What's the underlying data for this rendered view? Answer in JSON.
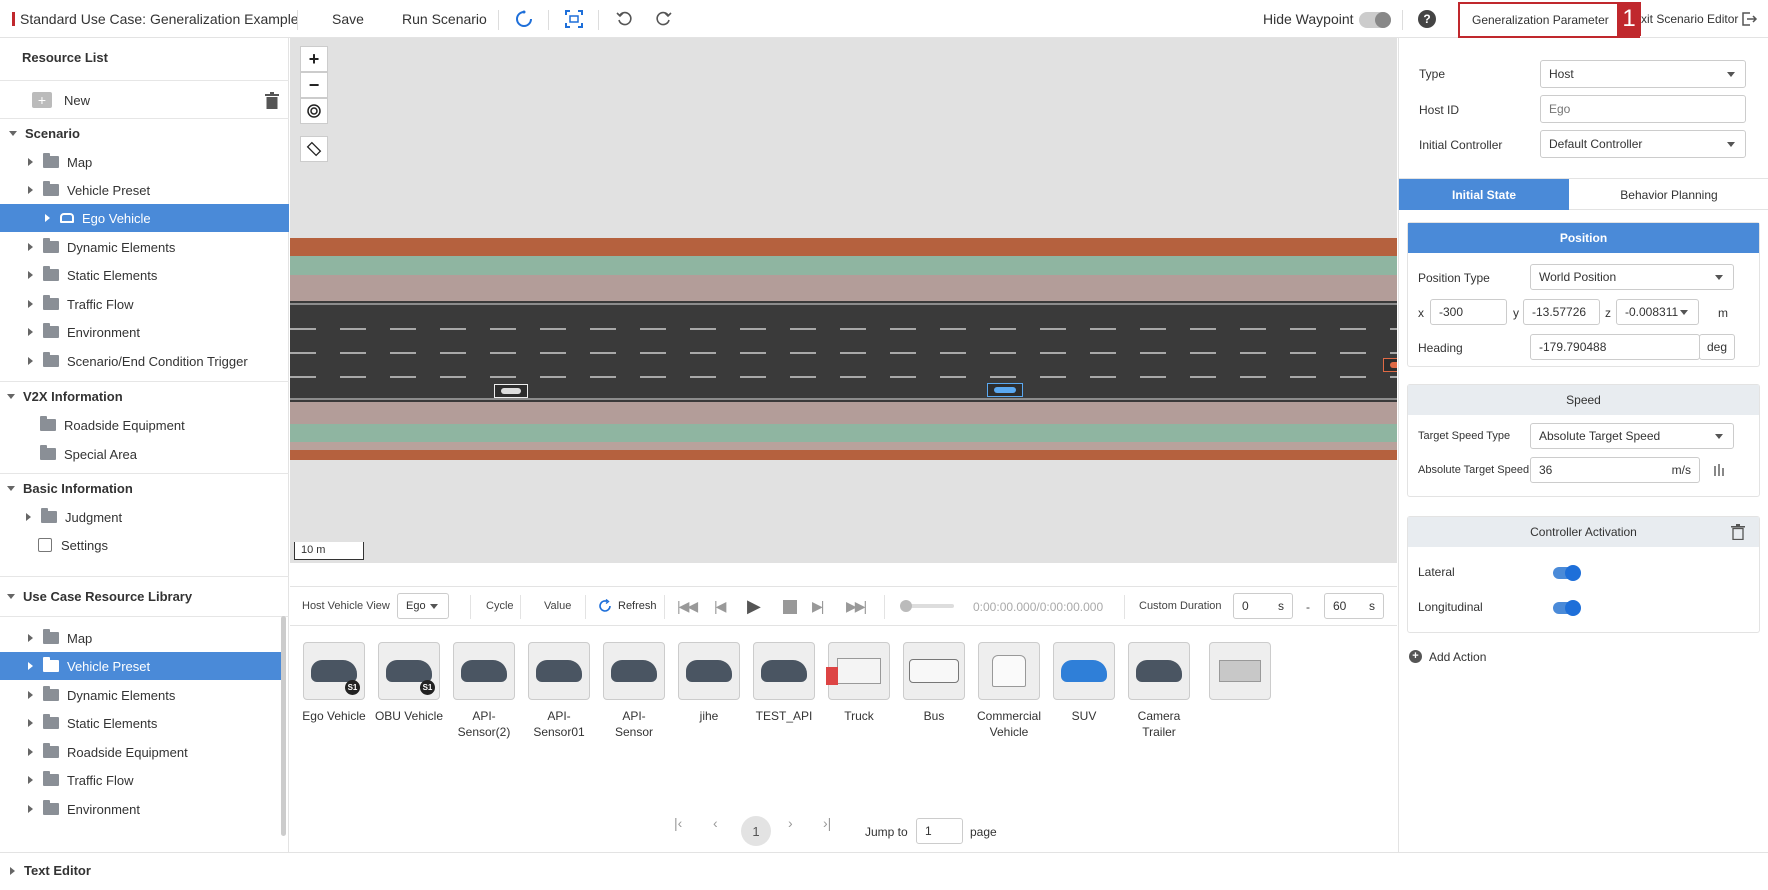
{
  "topbar": {
    "title": "Standard Use Case: Generalization Example",
    "save_label": "Save",
    "run_label": "Run Scenario",
    "hide_waypoint_label": "Hide Waypoint",
    "generalization_label": "Generalization Parameter",
    "annotation_number": "1",
    "exit_label": "xit Scenario Editor"
  },
  "sidebar": {
    "title": "Resource List",
    "new_label": "New",
    "scenario_title": "Scenario",
    "scenario_items": [
      "Map",
      "Vehicle Preset",
      "Ego Vehicle",
      "Dynamic Elements",
      "Static Elements",
      "Traffic Flow",
      "Environment",
      "Scenario/End Condition Trigger"
    ],
    "v2x_title": "V2X Information",
    "v2x_items": [
      "Roadside Equipment",
      "Special Area"
    ],
    "basic_title": "Basic Information",
    "basic_items": [
      "Judgment",
      "Settings"
    ],
    "library_title": "Use Case Resource Library",
    "library_items": [
      "Map",
      "Vehicle Preset",
      "Dynamic Elements",
      "Static Elements",
      "Roadside Equipment",
      "Traffic Flow",
      "Environment"
    ],
    "text_editor_label": "Text Editor"
  },
  "map": {
    "scale_label": "10 m"
  },
  "playback": {
    "host_view_label": "Host Vehicle View",
    "host_view_value": "Ego",
    "cycle_label": "Cycle",
    "value_label": "Value",
    "refresh_label": "Refresh",
    "time_label": "0:00:00.000/0:00:00.000",
    "custom_duration_label": "Custom Duration",
    "duration_start": "0",
    "duration_end": "60",
    "unit_s": "s",
    "dash": "-"
  },
  "vehicles": [
    {
      "label1": "Ego Vehicle",
      "label2": "",
      "badge": "S1"
    },
    {
      "label1": "OBU Vehicle",
      "label2": "",
      "badge": "S1"
    },
    {
      "label1": "API-",
      "label2": "Sensor(2)",
      "badge": ""
    },
    {
      "label1": "API-",
      "label2": "Sensor01",
      "badge": ""
    },
    {
      "label1": "API-",
      "label2": "Sensor",
      "badge": ""
    },
    {
      "label1": "jihe",
      "label2": "",
      "badge": ""
    },
    {
      "label1": "TEST_API",
      "label2": "",
      "badge": ""
    },
    {
      "label1": "Truck",
      "label2": "",
      "badge": ""
    },
    {
      "label1": "Bus",
      "label2": "",
      "badge": ""
    },
    {
      "label1": "Commercial",
      "label2": "Vehicle",
      "badge": ""
    },
    {
      "label1": "SUV",
      "label2": "",
      "badge": ""
    },
    {
      "label1": "Camera",
      "label2": "Trailer",
      "badge": ""
    }
  ],
  "pagination": {
    "current": "1",
    "jump_label": "Jump to",
    "jump_value": "1",
    "page_label": "page"
  },
  "props": {
    "type_label": "Type",
    "type_value": "Host",
    "host_id_label": "Host ID",
    "host_id_placeholder": "Ego",
    "controller_label": "Initial Controller",
    "controller_value": "Default Controller",
    "tab_initial": "Initial State",
    "tab_behavior": "Behavior Planning",
    "position_title": "Position",
    "position_type_label": "Position Type",
    "position_type_value": "World Position",
    "x_label": "x",
    "x_value": "-300",
    "y_label": "y",
    "y_value": "-13.57726",
    "z_label": "z",
    "z_value": "-0.008311",
    "unit_m": "m",
    "heading_label": "Heading",
    "heading_value": "-179.790488",
    "unit_deg": "deg",
    "speed_title": "Speed",
    "target_speed_type_label": "Target Speed Type",
    "target_speed_type_value": "Absolute Target Speed",
    "abs_speed_label": "Absolute Target Speed",
    "abs_speed_value": "36",
    "unit_ms": "m/s",
    "controller_title": "Controller Activation",
    "lateral_label": "Lateral",
    "longitudinal_label": "Longitudinal",
    "add_action_label": "Add Action"
  },
  "colors": {
    "accent": "#4a8ad8",
    "tab_active": "#4a8ad8",
    "annotation": "#c0282d"
  }
}
